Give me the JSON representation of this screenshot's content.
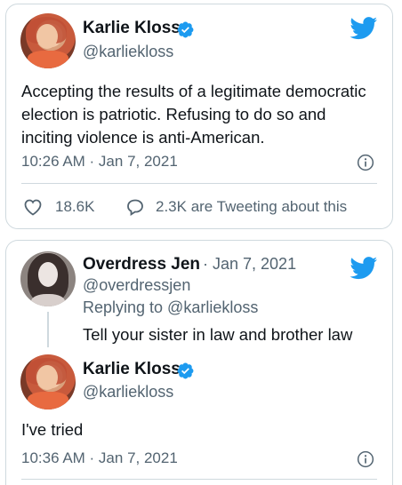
{
  "colors": {
    "brand_blue": "#1d9bf0",
    "text": "#0f1419",
    "secondary": "#536471",
    "border": "#cfd9de"
  },
  "tweet1": {
    "name": "Karlie Kloss",
    "handle": "@karliekloss",
    "text": "Accepting the results of a legitimate democratic election is patriotic. Refusing to do so and inciting violence is anti-American.",
    "timestamp": "10:26 AM · Jan 7, 2021",
    "likes": "18.6K",
    "tweeting_about": "2.3K are Tweeting about this",
    "icons": [
      "verified-badge-icon",
      "twitter-bird-icon",
      "info-icon",
      "heart-icon",
      "speech-bubble-icon"
    ]
  },
  "tweet2": {
    "reply": {
      "name": "Overdress Jen",
      "date": "· Jan 7, 2021",
      "handle": "@overdressjen",
      "replying_to": "Replying to @karliekloss",
      "text": "Tell your sister in law and brother law"
    },
    "response": {
      "name": "Karlie Kloss",
      "handle": "@karliekloss",
      "text": "I've tried",
      "timestamp": "10:36 AM · Jan 7, 2021"
    },
    "icons": [
      "twitter-bird-icon",
      "verified-badge-icon",
      "info-icon"
    ]
  }
}
